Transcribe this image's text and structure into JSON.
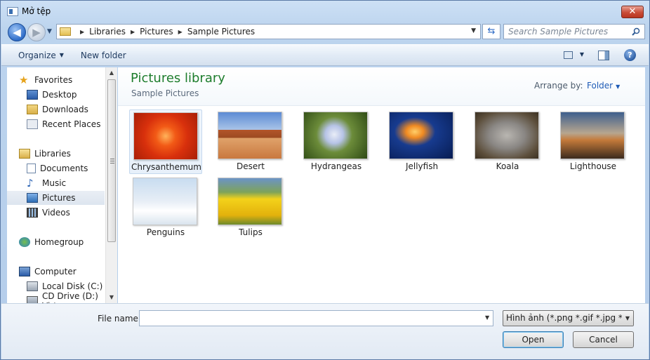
{
  "window": {
    "title": "Mở tệp",
    "close_label": "✕"
  },
  "nav": {
    "back_label": "◀",
    "forward_label": "▶",
    "history_label": "▼",
    "breadcrumbs": [
      "Libraries",
      "Pictures",
      "Sample Pictures"
    ],
    "search_placeholder": "Search Sample Pictures"
  },
  "toolbar": {
    "organize": "Organize",
    "new_folder": "New folder",
    "help": "?"
  },
  "sidebar": {
    "items": [
      {
        "label": "Favorites",
        "icon": "star-icon"
      },
      {
        "label": "Desktop",
        "icon": "desktop-icon"
      },
      {
        "label": "Downloads",
        "icon": "downloads-icon"
      },
      {
        "label": "Recent Places",
        "icon": "recent-places-icon"
      },
      {
        "label": "Libraries",
        "icon": "libraries-icon"
      },
      {
        "label": "Documents",
        "icon": "documents-icon"
      },
      {
        "label": "Music",
        "icon": "music-icon"
      },
      {
        "label": "Pictures",
        "icon": "pictures-icon",
        "selected": true
      },
      {
        "label": "Videos",
        "icon": "videos-icon"
      },
      {
        "label": "Homegroup",
        "icon": "homegroup-icon"
      },
      {
        "label": "Computer",
        "icon": "computer-icon"
      },
      {
        "label": "Local Disk (C:)",
        "icon": "local-disk-icon"
      },
      {
        "label": "CD Drive (D:) Virt",
        "icon": "cd-drive-icon"
      }
    ]
  },
  "library": {
    "title": "Pictures library",
    "subtitle": "Sample Pictures",
    "arrange_label": "Arrange by:",
    "arrange_value": "Folder"
  },
  "files": [
    {
      "name": "Chrysanthemum",
      "selected": true
    },
    {
      "name": "Desert"
    },
    {
      "name": "Hydrangeas"
    },
    {
      "name": "Jellyfish"
    },
    {
      "name": "Koala"
    },
    {
      "name": "Lighthouse"
    },
    {
      "name": "Penguins"
    },
    {
      "name": "Tulips"
    }
  ],
  "footer": {
    "file_name_label": "File name:",
    "file_name_value": "",
    "filter_value": "Hình ảnh (*.png *.gif *.jpg *.jpe",
    "open_label": "Open",
    "cancel_label": "Cancel"
  }
}
